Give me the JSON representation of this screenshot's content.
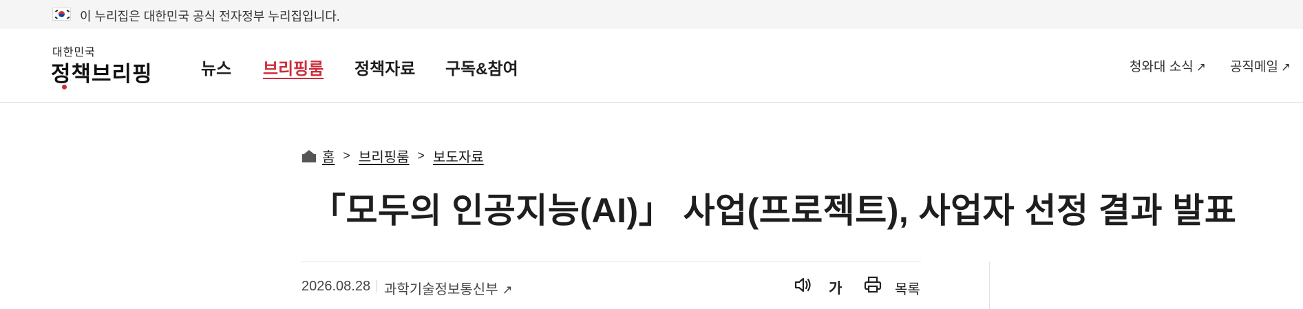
{
  "gov_banner": {
    "text": "이 누리집은 대한민국 공식 전자정부 누리집입니다.",
    "flag_icon": "korea-flag-icon"
  },
  "header": {
    "logo_small": "대한민국",
    "logo_main": "정책브리핑",
    "nav": [
      {
        "label": "뉴스",
        "active": false
      },
      {
        "label": "브리핑룸",
        "active": true
      },
      {
        "label": "정책자료",
        "active": false
      },
      {
        "label": "구독&참여",
        "active": false
      }
    ],
    "utility": [
      {
        "label": "청와대 소식",
        "icon": "external-link-icon"
      },
      {
        "label": "공직메일",
        "icon": "external-link-icon"
      }
    ]
  },
  "breadcrumb": {
    "home_icon": "home-icon",
    "items": [
      "홈",
      "브리핑룸",
      "보도자료"
    ]
  },
  "article": {
    "title": "「모두의 인공지능(AI)」 사업(프로젝트), 사업자 선정 결과 발표",
    "date": "2026.08.28",
    "department": "과학기술정보통신부"
  },
  "tools": {
    "speaker_icon": "speaker-icon",
    "font_label": "가",
    "print_icon": "print-icon",
    "list_label": "목록"
  },
  "colors": {
    "accent": "#cd2e3a",
    "banner_bg": "#f5f5f5",
    "text": "#1e1e1e"
  }
}
